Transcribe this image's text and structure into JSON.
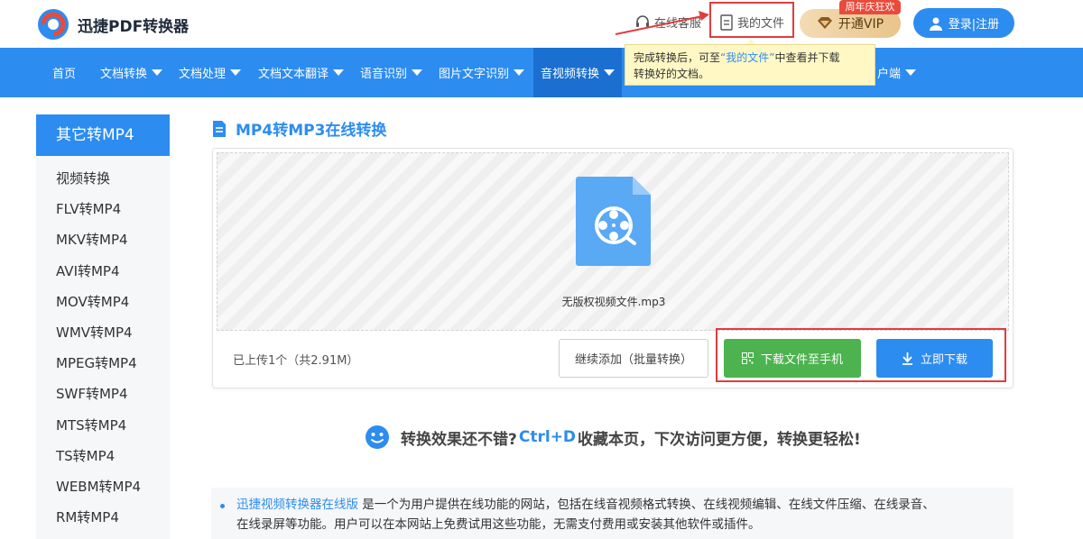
{
  "header": {
    "logo_text": "迅捷PDF转换器",
    "service_label": "在线客服",
    "myfiles_label": "我的文件",
    "vip_label": "开通VIP",
    "vip_badge": "周年庆狂欢",
    "login_label": "登录|注册"
  },
  "nav": {
    "items": [
      {
        "label": "首页"
      },
      {
        "label": "文档转换"
      },
      {
        "label": "文档处理"
      },
      {
        "label": "文档文本翻译"
      },
      {
        "label": "语音识别"
      },
      {
        "label": "图片文字识别"
      },
      {
        "label": "音视频转换"
      },
      {
        "label": "户端"
      }
    ]
  },
  "tooltip": {
    "part1": "完成转换后，可至",
    "link": "“我的文件”",
    "part2": "中查看并下载",
    "line2": "转换好的文档。"
  },
  "sidebar": {
    "title": "其它转MP4",
    "items": [
      {
        "label": "视频转换"
      },
      {
        "label": "FLV转MP4"
      },
      {
        "label": "MKV转MP4"
      },
      {
        "label": "AVI转MP4"
      },
      {
        "label": "MOV转MP4"
      },
      {
        "label": "WMV转MP4"
      },
      {
        "label": "MPEG转MP4"
      },
      {
        "label": "SWF转MP4"
      },
      {
        "label": "MTS转MP4"
      },
      {
        "label": "TS转MP4"
      },
      {
        "label": "WEBM转MP4"
      },
      {
        "label": "RM转MP4"
      }
    ]
  },
  "main": {
    "title": "MP4转MP3在线转换",
    "file_name": "无版权视频文件.mp3",
    "status": "已上传1个（共2.91M）",
    "add_button": "继续添加（批量转换）",
    "phone_button": "下载文件至手机",
    "download_button": "立即下载"
  },
  "promo": {
    "part1": "转换效果还不错?",
    "shortcut": "Ctrl+D",
    "part2": "收藏本页，下次访问更方便，转换更轻松!"
  },
  "desc": {
    "link": "迅捷视频转换器在线版",
    "text1": " 是一个为用户提供在线功能的网站，包括在线音视频格式转换、在线视频编辑、在线文件压缩、在线录音、",
    "text2": "在线录屏等功能。用户可以在本网站上免费试用这些功能，无需支付费用或安装其他软件或插件。"
  },
  "colors": {
    "brand": "#2d8cf0",
    "green": "#4cb34f",
    "highlight": "#e23c3c"
  }
}
